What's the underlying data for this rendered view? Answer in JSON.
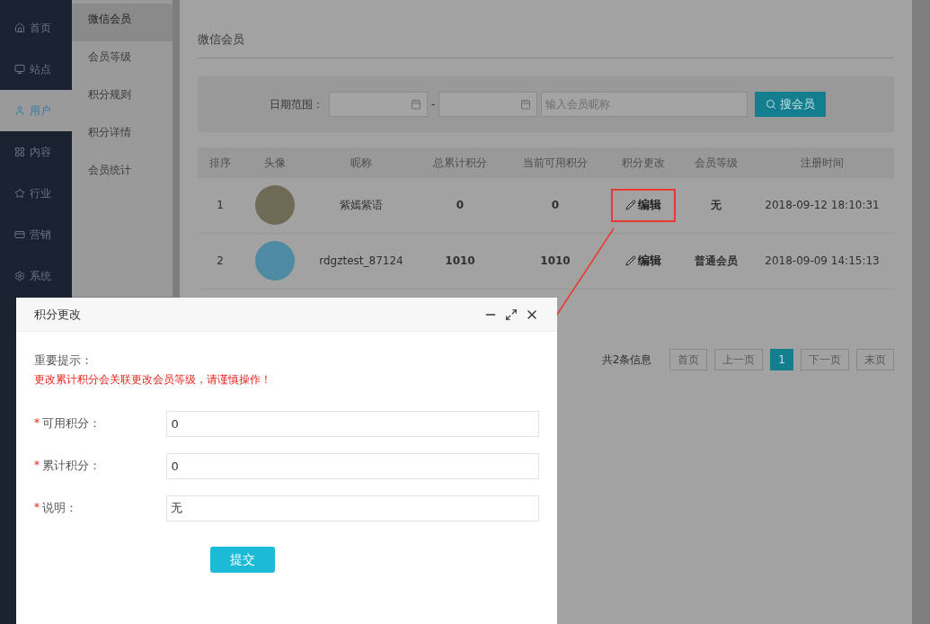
{
  "nav": {
    "items": [
      {
        "label": "首页",
        "selected": false
      },
      {
        "label": "站点",
        "selected": false
      },
      {
        "label": "用户",
        "selected": true
      },
      {
        "label": "内容",
        "selected": false
      },
      {
        "label": "行业",
        "selected": false
      },
      {
        "label": "营销",
        "selected": false
      },
      {
        "label": "系统",
        "selected": false
      }
    ]
  },
  "submenu": {
    "items": [
      {
        "label": "微信会员",
        "selected": true
      },
      {
        "label": "会员等级",
        "selected": false
      },
      {
        "label": "积分规则",
        "selected": false
      },
      {
        "label": "积分详情",
        "selected": false
      },
      {
        "label": "会员统计",
        "selected": false
      }
    ]
  },
  "page_title": "微信会员",
  "filter": {
    "date_label": "日期范围：",
    "separator": "-",
    "nickname_placeholder": "输入会员昵称",
    "search_button": "搜会员"
  },
  "table": {
    "columns": [
      "排序",
      "头像",
      "昵称",
      "总累计积分",
      "当前可用积分",
      "积分更改",
      "会员等级",
      "注册时间"
    ],
    "rows": [
      {
        "index": "1",
        "nickname": "紫嫣紫语",
        "total": "0",
        "available": "0",
        "edit": "编辑",
        "highlighted": true,
        "level": "无",
        "registered": "2018-09-12 18:10:31"
      },
      {
        "index": "2",
        "nickname": "rdgztest_87124",
        "total": "1010",
        "available": "1010",
        "edit": "编辑",
        "highlighted": false,
        "level": "普通会员",
        "registered": "2018-09-09 14:15:13"
      }
    ]
  },
  "pagination": {
    "summary": "共2条信息",
    "pages": [
      {
        "label": "首页",
        "selected": false
      },
      {
        "label": "上一页",
        "selected": false
      },
      {
        "label": "1",
        "selected": true
      },
      {
        "label": "下一页",
        "selected": false
      },
      {
        "label": "末页",
        "selected": false
      }
    ]
  },
  "dialog": {
    "title": "积分更改",
    "notice_title": "重要提示：",
    "notice_text": "更改累计积分会关联更改会员等级，请谨慎操作！",
    "fields": [
      {
        "label": "可用积分：",
        "value": "0",
        "required_mark": "*"
      },
      {
        "label": "累计积分：",
        "value": "0",
        "required_mark": "*"
      },
      {
        "label": "说明：",
        "value": "无",
        "required_mark": "*"
      }
    ],
    "submit": "提交"
  }
}
